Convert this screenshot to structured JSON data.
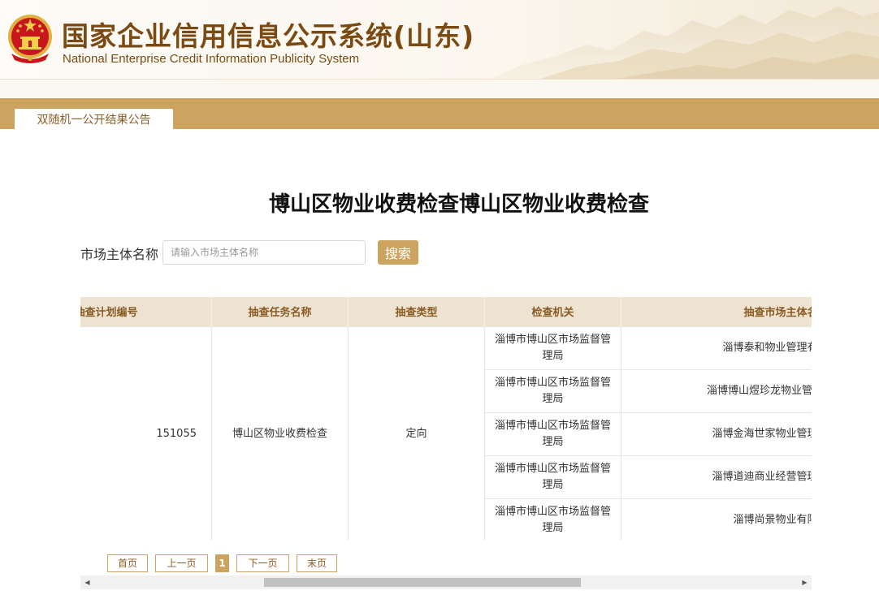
{
  "header": {
    "title": "国家企业信用信息公示系统(山东)",
    "subtitle": "National Enterprise Credit Information Publicity System"
  },
  "tab": {
    "label": "双随机一公开结果公告"
  },
  "page_title": "博山区物业收费检查博山区物业收费检查",
  "search": {
    "label": "市场主体名称",
    "placeholder": "请输入市场主体名称",
    "button": "搜索"
  },
  "table": {
    "headers": [
      "抽查计划编号",
      "抽查任务名称",
      "抽查类型",
      "检查机关",
      "抽查市场主体名称"
    ],
    "task_number_visible": "151055",
    "task_name": "博山区物业收费检查",
    "check_type": "定向",
    "rows": [
      {
        "authority": "淄博市博山区市场监督管理局",
        "entity": "淄博泰和物业管理有限公司"
      },
      {
        "authority": "淄博市博山区市场监督管理局",
        "entity": "淄博博山煜珍龙物业管理有限公司"
      },
      {
        "authority": "淄博市博山区市场监督管理局",
        "entity": "淄博金海世家物业管理有限公司"
      },
      {
        "authority": "淄博市博山区市场监督管理局",
        "entity": "淄博道迪商业经营管理有限公司"
      },
      {
        "authority": "淄博市博山区市场监督管理局",
        "entity": "淄博尚景物业有限公司"
      }
    ]
  },
  "pagination": {
    "first": "首页",
    "prev": "上一页",
    "current": "1",
    "next": "下一页",
    "last": "末页"
  },
  "colors": {
    "brand_gold": "#cda45f",
    "title_brown": "#7a4a12",
    "header_cell": "#ede3d0",
    "emblem_red": "#c8161d"
  }
}
